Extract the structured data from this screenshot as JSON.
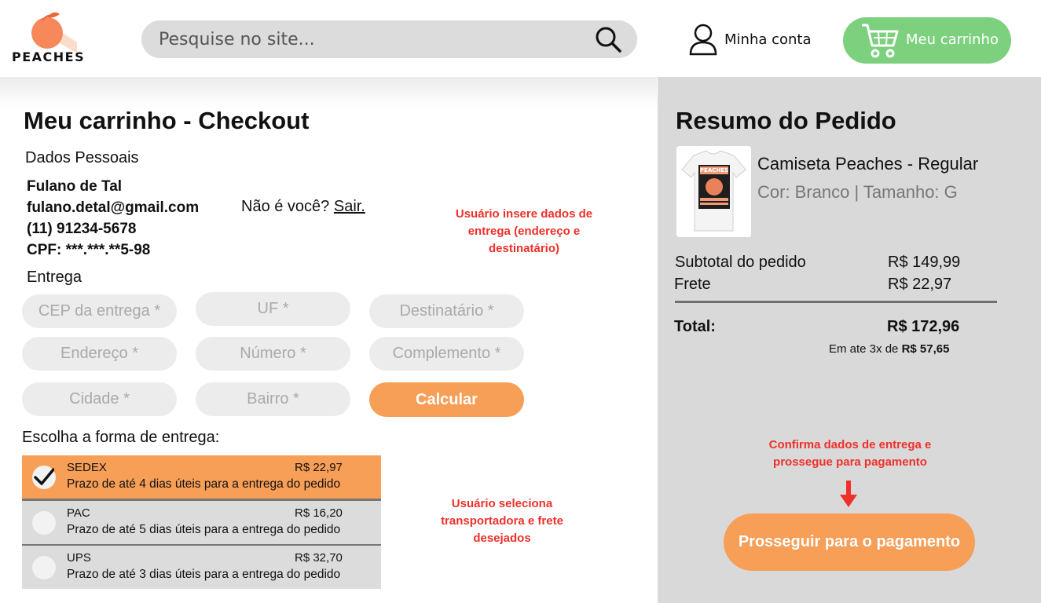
{
  "header": {
    "logo_text": "PEACHES",
    "search_placeholder": "Pesquise no site...",
    "account_label": "Minha conta",
    "cart_label": "Meu carrinho"
  },
  "checkout": {
    "title": "Meu carrinho - Checkout",
    "personal_section": "Dados Pessoais",
    "name": "Fulano de Tal",
    "email": "fulano.detal@gmail.com",
    "phone": "(11) 91234-5678",
    "cpf": "CPF: ***.***.**5-98",
    "not_you": "Não é você?",
    "logout": "Sair.",
    "delivery_section": "Entrega",
    "fields": {
      "cep": "CEP da entrega *",
      "uf": "UF *",
      "recipient": "Destinatário *",
      "address": "Endereço *",
      "number": "Número *",
      "complement": "Complemento *",
      "city": "Cidade *",
      "district": "Bairro *"
    },
    "calculate_label": "Calcular",
    "shipping_prompt": "Escolha a forma de entrega:",
    "shipping_options": [
      {
        "name": "SEDEX",
        "price": "R$ 22,97",
        "description": "Prazo de até 4 dias úteis para a entrega do pedido",
        "selected": true
      },
      {
        "name": "PAC",
        "price": "R$ 16,20",
        "description": "Prazo de até 5 dias úteis para a entrega do pedido",
        "selected": false
      },
      {
        "name": "UPS",
        "price": "R$ 32,70",
        "description": "Prazo de até 3 dias úteis para a entrega do pedido",
        "selected": false
      }
    ]
  },
  "notes": {
    "delivery": [
      "Usuário insere dados de",
      "entrega (endereço e",
      "destinatário)"
    ],
    "shipping": [
      "Usuário seleciona",
      "transportadora e frete",
      "desejados"
    ],
    "proceed": [
      "Confirma dados de entrega e",
      "prossegue para pagamento"
    ]
  },
  "summary": {
    "title": "Resumo do Pedido",
    "product_name": "Camiseta Peaches - Regular",
    "product_attrs": "Cor: Branco | Tamanho: G",
    "product_image_text": "PEACHES",
    "subtotal_label": "Subtotal do pedido",
    "subtotal_value": "R$ 149,99",
    "shipping_label": "Frete",
    "shipping_value": "R$ 22,97",
    "total_label": "Total:",
    "total_value": "R$ 172,96",
    "installments_prefix": "Em ate 3x de",
    "installments_value": "R$ 57,65",
    "proceed_label": "Prosseguir para o pagamento"
  },
  "colors": {
    "accent_orange": "#f79e57",
    "cart_green": "#7dd07e",
    "note_red": "#f0302a",
    "panel_gray": "#d9d9d9"
  }
}
